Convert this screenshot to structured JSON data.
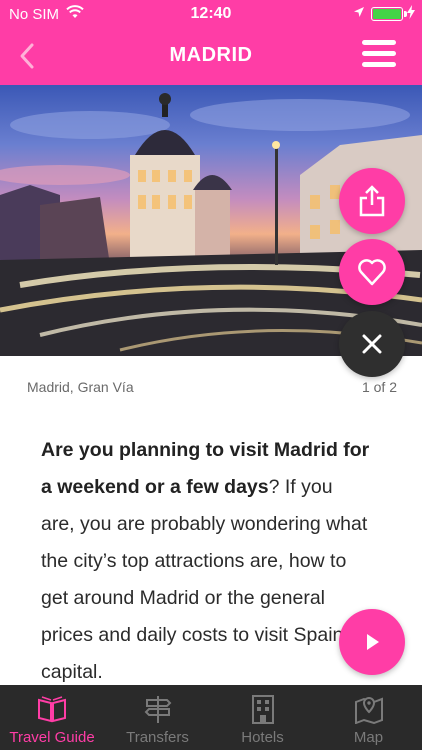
{
  "status_bar": {
    "carrier": "No SIM",
    "time": "12:40"
  },
  "header": {
    "title": "MADRID"
  },
  "caption": {
    "text": "Madrid, Gran Vía",
    "counter": "1 of 2"
  },
  "article": {
    "bold_text": "Are you planning to visit Madrid for a weekend or a few days",
    "body_text": "? If you are, you are probably wondering what the city’s top attractions are, how to get around Madrid or the general prices and daily costs to visit Spain's capital."
  },
  "tabs": [
    {
      "label": "Travel Guide",
      "icon": "book-icon",
      "active": true
    },
    {
      "label": "Transfers",
      "icon": "signpost-icon",
      "active": false
    },
    {
      "label": "Hotels",
      "icon": "hotel-icon",
      "active": false
    },
    {
      "label": "Map",
      "icon": "map-icon",
      "active": false
    }
  ],
  "colors": {
    "accent": "#ff3da6",
    "tabbar": "#2a2a2a",
    "close_button": "#2f2f2f",
    "battery": "#44d447"
  }
}
